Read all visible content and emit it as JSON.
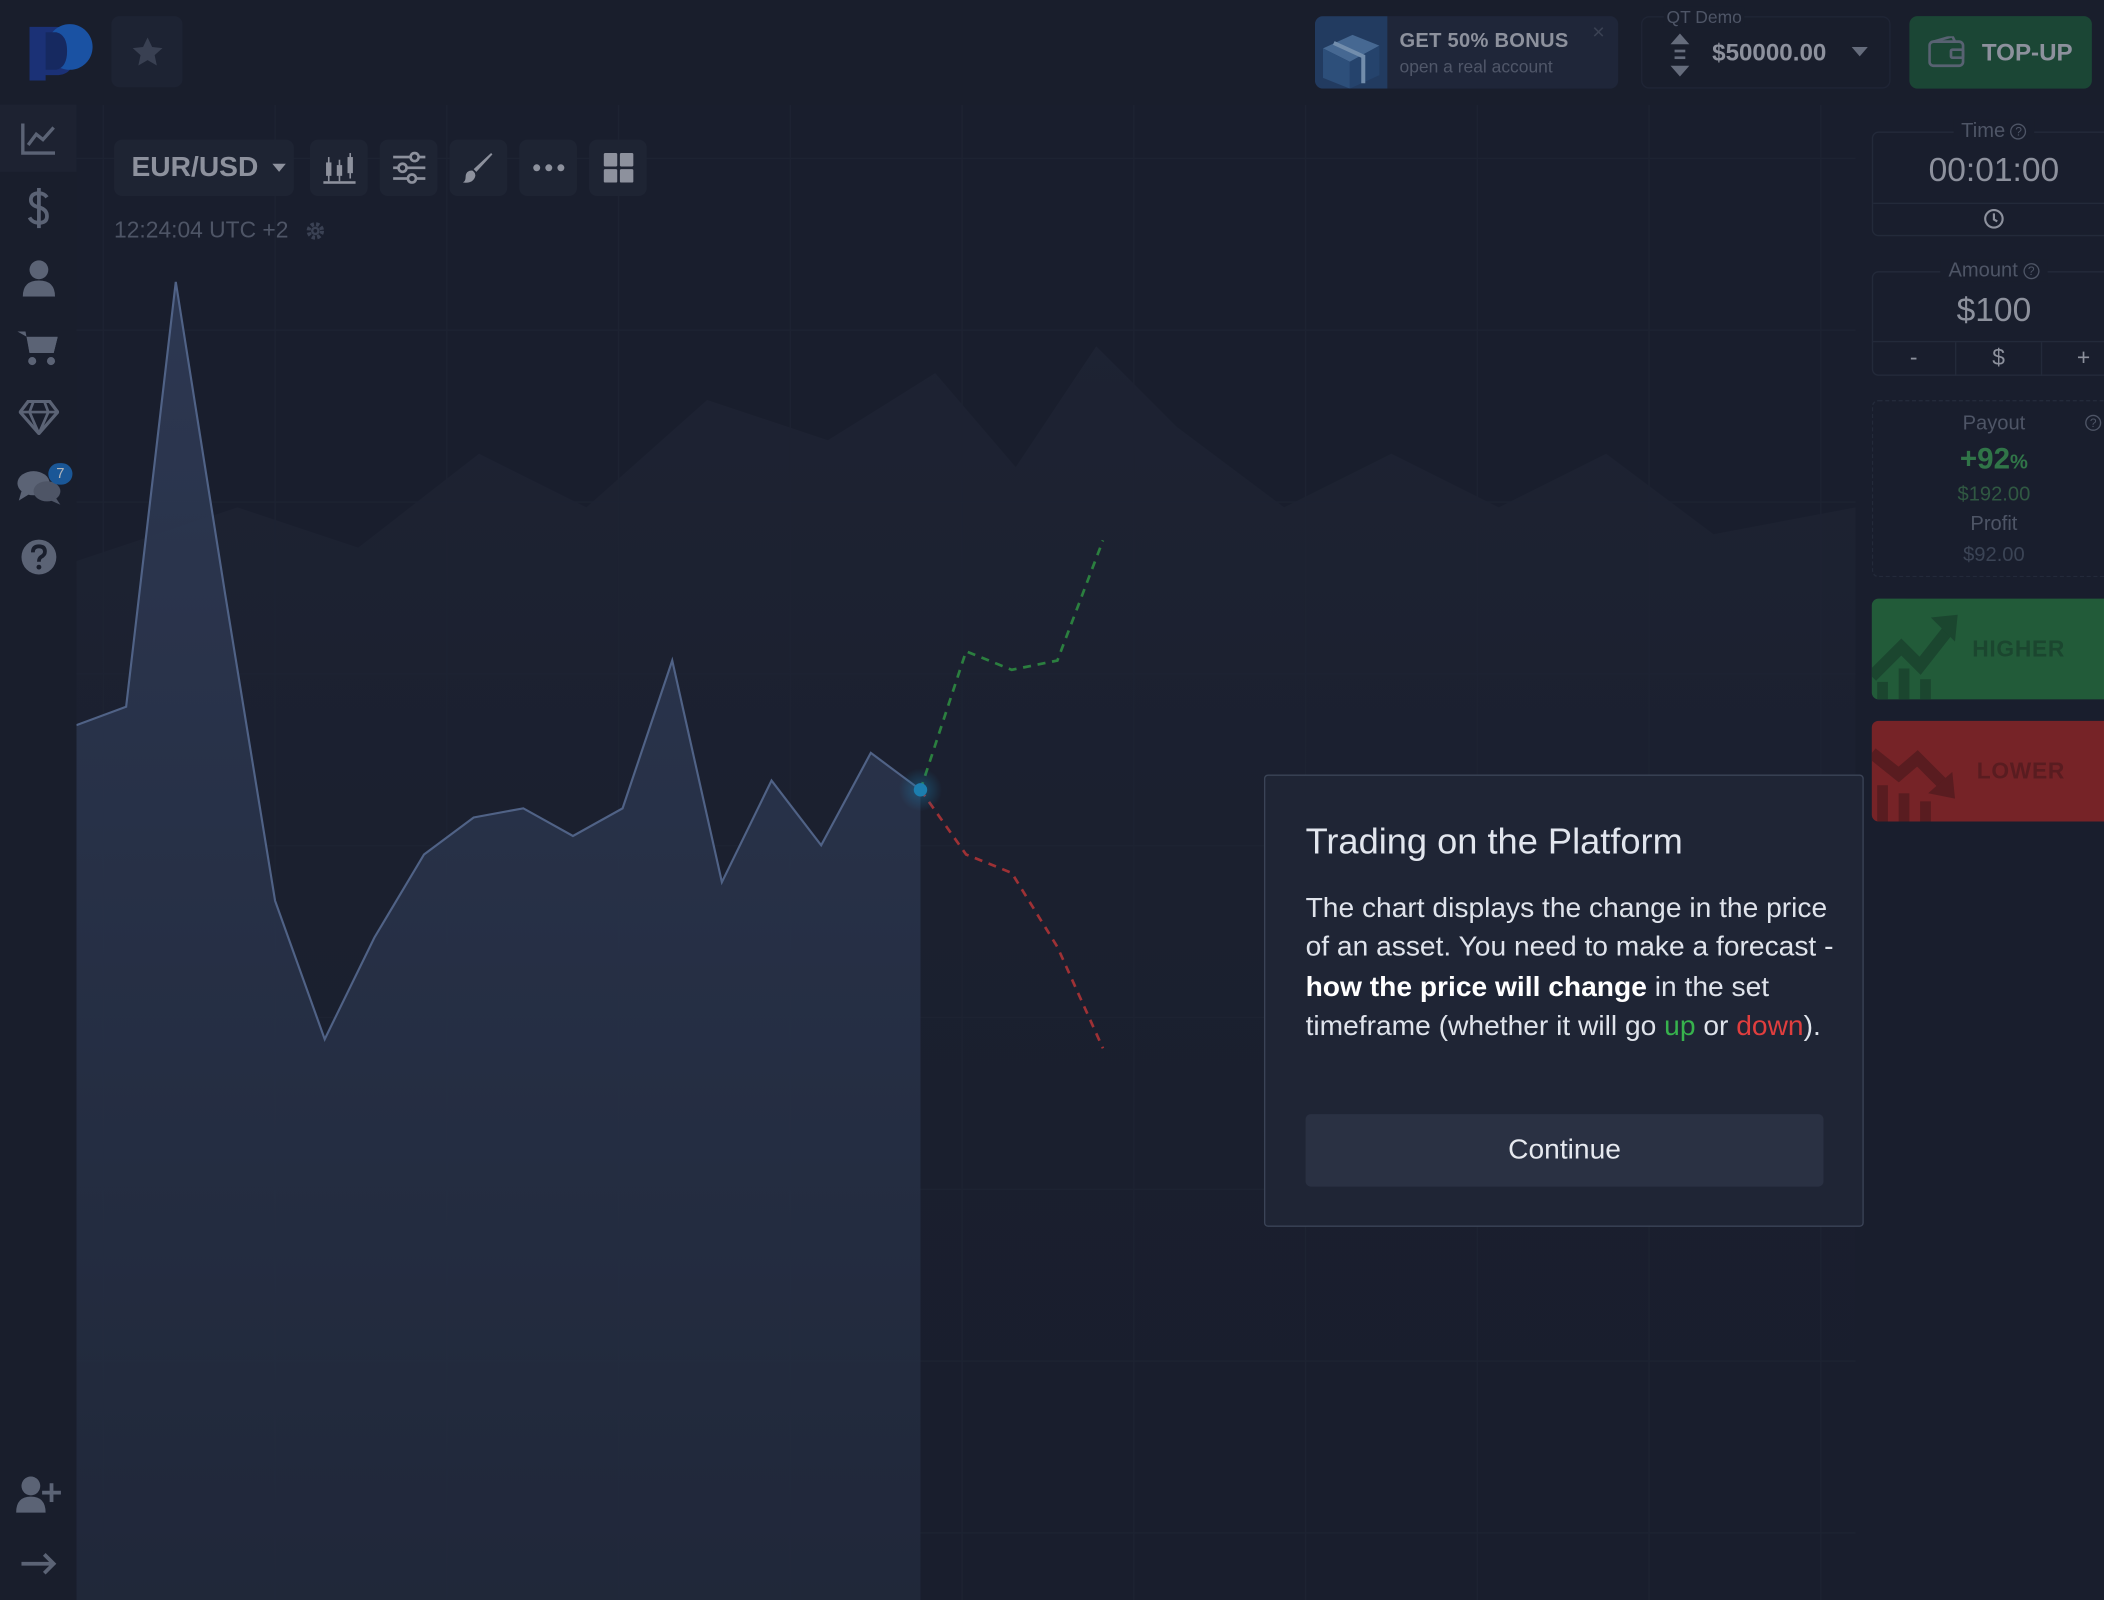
{
  "header": {
    "bonus": {
      "title": "GET 50% BONUS",
      "subtitle": "open a real account",
      "close": "×"
    },
    "account": {
      "label": "QT Demo",
      "balance": "$50000.00"
    },
    "topup_label": "TOP-UP"
  },
  "sidebar": {
    "items": [
      {
        "name": "trading",
        "icon": "chart-line-icon"
      },
      {
        "name": "finance",
        "icon": "dollar-icon"
      },
      {
        "name": "profile",
        "icon": "user-icon"
      },
      {
        "name": "market",
        "icon": "cart-icon"
      },
      {
        "name": "achievements",
        "icon": "diamond-icon"
      },
      {
        "name": "chat",
        "icon": "chat-icon",
        "badge": "7"
      },
      {
        "name": "help",
        "icon": "help-icon"
      }
    ],
    "bottom": [
      {
        "name": "add-account",
        "icon": "user-plus-icon"
      },
      {
        "name": "logout",
        "icon": "arrow-right-icon"
      }
    ]
  },
  "chart": {
    "pair": "EUR/USD",
    "clock": "12:24:04 UTC +2",
    "colors": {
      "area": "#3b4a6b",
      "line": "#6d87b6",
      "up": "#37b24d",
      "down": "#e03e3e",
      "marker": "#21b0f2"
    }
  },
  "chart_data": {
    "type": "area",
    "series": [
      {
        "values": [
          0.52,
          0.54,
          1.0,
          0.66,
          0.33,
          0.18,
          0.29,
          0.38,
          0.42,
          0.43,
          0.4,
          0.43,
          0.59,
          0.35,
          0.46,
          0.39,
          0.49,
          0.45
        ]
      }
    ],
    "forecast_up": [
      0.45,
      0.6,
      0.58,
      0.59,
      0.72
    ],
    "forecast_down": [
      0.45,
      0.38,
      0.36,
      0.28,
      0.17
    ]
  },
  "panel": {
    "time": {
      "label": "Time",
      "value": "00:01:00"
    },
    "amount": {
      "label": "Amount",
      "value": "$100",
      "minus": "-",
      "currency": "$",
      "plus": "+"
    },
    "payout": {
      "label": "Payout",
      "percent": "+92",
      "percent_sign": "%",
      "payout_value": "$192.00",
      "profit_label": "Profit",
      "profit_value": "$92.00"
    },
    "higher_label": "HIGHER",
    "lower_label": "LOWER"
  },
  "modal": {
    "title": "Trading on the Platform",
    "text_1": "The chart displays the change in the price of an asset. You need to make a forecast - ",
    "text_bold": "how the price will change",
    "text_2": " in the set timeframe (whether it will go ",
    "text_up": "up",
    "text_3": " or ",
    "text_down": "down",
    "text_4": ").",
    "continue_label": "Continue"
  }
}
